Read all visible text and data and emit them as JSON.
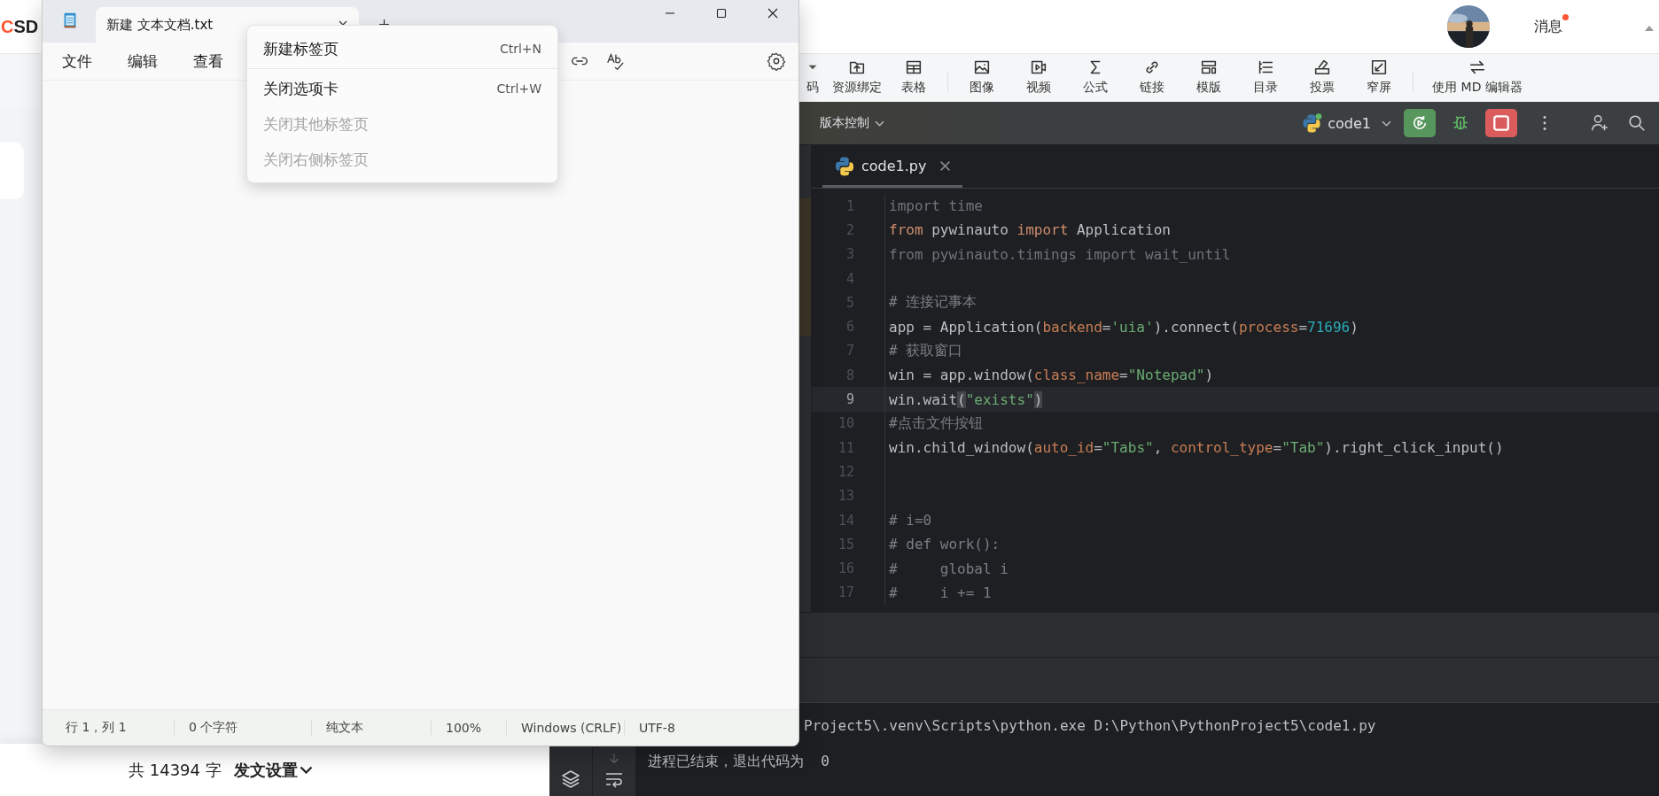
{
  "browser": {
    "logo": "CSD",
    "messages": {
      "label": "消息",
      "unread": true
    },
    "toolbar": [
      "码",
      "资源绑定",
      "表格",
      "图像",
      "视频",
      "公式",
      "链接",
      "模版",
      "目录",
      "投票",
      "窄屏",
      "使用 MD 编辑器"
    ],
    "word_count": "共 14394 字",
    "publish_settings": "发文设置"
  },
  "ide": {
    "vcs_menu": "版本控制",
    "run_config": "code1",
    "editor_tab": {
      "label": "code1.py",
      "selected": true
    },
    "lines": [
      {
        "number": "1",
        "current": false,
        "tokens": [
          {
            "t": "import time",
            "kind": "dim"
          }
        ]
      },
      {
        "number": "2",
        "current": false,
        "tokens": [
          {
            "t": "from",
            "kind": "kw"
          },
          {
            "t": " pywinauto ",
            "kind": "plain"
          },
          {
            "t": "import",
            "kind": "kw"
          },
          {
            "t": " Application",
            "kind": "plain"
          }
        ]
      },
      {
        "number": "3",
        "current": false,
        "tokens": [
          {
            "t": "from pywinauto.timings import wait_until",
            "kind": "dim"
          }
        ]
      },
      {
        "number": "4",
        "current": false
      },
      {
        "number": "5",
        "current": false,
        "tokens": [
          {
            "t": "# 连接记事本",
            "kind": "comment"
          }
        ]
      },
      {
        "number": "6",
        "current": false,
        "tokens": [
          {
            "t": "app = Application(",
            "kind": "plain"
          },
          {
            "t": "backend",
            "kind": "param"
          },
          {
            "t": "=",
            "kind": "plain"
          },
          {
            "t": "'uia'",
            "kind": "str"
          },
          {
            "t": ").connect(",
            "kind": "plain"
          },
          {
            "t": "process",
            "kind": "param"
          },
          {
            "t": "=",
            "kind": "plain"
          },
          {
            "t": "71696",
            "kind": "num"
          },
          {
            "t": ")",
            "kind": "plain"
          }
        ]
      },
      {
        "number": "7",
        "current": false,
        "tokens": [
          {
            "t": "# 获取窗口",
            "kind": "comment"
          }
        ]
      },
      {
        "number": "8",
        "current": false,
        "tokens": [
          {
            "t": "win = app.window(",
            "kind": "plain"
          },
          {
            "t": "class_name",
            "kind": "param"
          },
          {
            "t": "=",
            "kind": "plain"
          },
          {
            "t": "\"Notepad\"",
            "kind": "str"
          },
          {
            "t": ")",
            "kind": "plain"
          }
        ]
      },
      {
        "number": "9",
        "current": true,
        "tokens": [
          {
            "t": "win.wait",
            "kind": "plain"
          },
          {
            "t": "(",
            "kind": "match"
          },
          {
            "t": "\"exists\"",
            "kind": "str"
          },
          {
            "t": ")",
            "kind": "match"
          }
        ]
      },
      {
        "number": "10",
        "current": false,
        "tokens": [
          {
            "t": "#点击文件按钮",
            "kind": "comment"
          }
        ]
      },
      {
        "number": "11",
        "current": false,
        "tokens": [
          {
            "t": "win.child_window(",
            "kind": "plain"
          },
          {
            "t": "auto_id",
            "kind": "param"
          },
          {
            "t": "=",
            "kind": "plain"
          },
          {
            "t": "\"Tabs\"",
            "kind": "str"
          },
          {
            "t": ", ",
            "kind": "plain"
          },
          {
            "t": "control_type",
            "kind": "param"
          },
          {
            "t": "=",
            "kind": "plain"
          },
          {
            "t": "\"Tab\"",
            "kind": "str"
          },
          {
            "t": ").right_click_input()",
            "kind": "plain"
          }
        ]
      },
      {
        "number": "12",
        "current": false
      },
      {
        "number": "13",
        "current": false
      },
      {
        "number": "14",
        "current": false,
        "tokens": [
          {
            "t": "# i=0",
            "kind": "comment"
          }
        ]
      },
      {
        "number": "15",
        "current": false,
        "tokens": [
          {
            "t": "# def work():",
            "kind": "comment"
          }
        ]
      },
      {
        "number": "16",
        "current": false,
        "tokens": [
          {
            "t": "#     global i",
            "kind": "comment"
          }
        ]
      },
      {
        "number": "17",
        "current": false,
        "tokens": [
          {
            "t": "#     i += 1",
            "kind": "comment"
          }
        ]
      }
    ],
    "console": [
      "Project5\\.venv\\Scripts\\python.exe D:\\Python\\PythonProject5\\code1.py",
      "进程已结束，退出代码为  0"
    ]
  },
  "notepad": {
    "tab": {
      "title": "新建 文本文档.txt",
      "selected": true
    },
    "menu": [
      "文件",
      "编辑",
      "查看"
    ],
    "status_bar": [
      "行 1，列 1",
      "0 个字符",
      "纯文本",
      "100%",
      "Windows (CRLF)",
      "UTF-8"
    ]
  },
  "context_menu": [
    {
      "label": "新建标签页",
      "shortcut": "Ctrl+N",
      "disabled": false,
      "separator_after": true
    },
    {
      "label": "关闭选项卡",
      "shortcut": "Ctrl+W",
      "disabled": false,
      "separator_after": false
    },
    {
      "label": "关闭其他标签页",
      "disabled": true,
      "separator_after": false
    },
    {
      "label": "关闭右侧标签页",
      "disabled": true,
      "separator_after": false
    }
  ]
}
